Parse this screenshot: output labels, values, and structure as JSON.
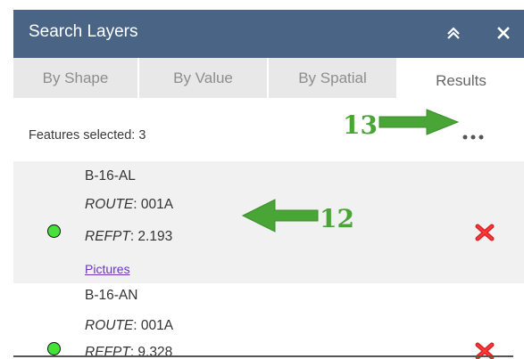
{
  "panel": {
    "title": "Search Layers",
    "collapse_icon": "double-chevron-up-icon",
    "close_icon": "close-icon",
    "header_color": "#4a6486"
  },
  "tabs": [
    {
      "label": "By Shape",
      "active": false
    },
    {
      "label": "By Value",
      "active": false
    },
    {
      "label": "By Spatial",
      "active": false
    },
    {
      "label": "Results",
      "active": true
    }
  ],
  "results": {
    "features_selected_label": "Features selected: 3",
    "more_icon": "ellipsis-icon",
    "items": [
      {
        "id": "B-16-AL",
        "route_label": "ROUTE",
        "route_value": ": 001A",
        "refpt_label": "REFPT",
        "refpt_value": ": 2.193",
        "link": "Pictures",
        "status_color": "#46e23a",
        "remove_icon": "red-x-remove-icon"
      },
      {
        "id": "B-16-AN",
        "route_label": "ROUTE",
        "route_value": ": 001A",
        "refpt_label": "REFPT",
        "refpt_value": ": 9.328",
        "status_color": "#46e23a",
        "remove_icon": "red-x-remove-icon"
      }
    ]
  },
  "callouts": [
    {
      "number": "13",
      "icon": "green-arrow-right-icon",
      "color": "#49a535"
    },
    {
      "number": "12",
      "icon": "green-arrow-left-icon",
      "color": "#49a535"
    }
  ]
}
